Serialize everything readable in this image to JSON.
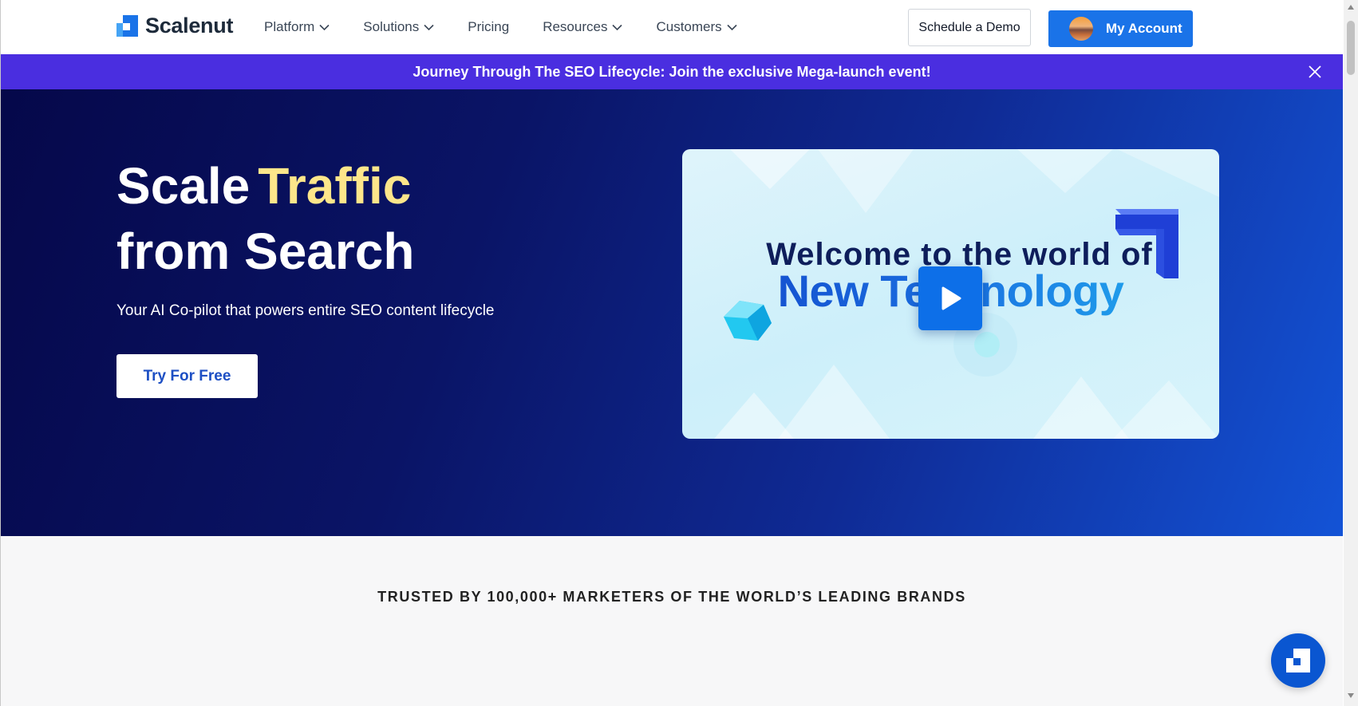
{
  "header": {
    "logo_text": "Scalenut",
    "nav": [
      {
        "label": "Platform",
        "has_dropdown": true
      },
      {
        "label": "Solutions",
        "has_dropdown": true
      },
      {
        "label": "Pricing",
        "has_dropdown": false
      },
      {
        "label": "Resources",
        "has_dropdown": true
      },
      {
        "label": "Customers",
        "has_dropdown": true
      }
    ],
    "schedule_demo": "Schedule a Demo",
    "my_account": "My Account"
  },
  "announcement": {
    "text": "Journey Through The SEO Lifecycle: Join the exclusive Mega-launch event!"
  },
  "hero": {
    "title_part1": "Scale",
    "title_accent": "Traffic",
    "title_line2": "from Search",
    "subtitle": "Your AI Co-pilot that powers entire SEO content lifecycle",
    "cta": "Try For Free",
    "video": {
      "line1": "Welcome to the world of",
      "line2": "New Technology"
    }
  },
  "trusted": {
    "text": "TRUSTED BY 100,000+ MARKETERS OF THE WORLD’S LEADING BRANDS"
  },
  "colors": {
    "brand_blue": "#1a73e8",
    "announcement_bg": "#4a2ee0",
    "hero_accent": "#fde68a",
    "hero_dark": "#05084a"
  },
  "icons": [
    "scalenut-logo-icon",
    "chevron-down-icon",
    "close-icon",
    "play-icon",
    "chat-widget-icon"
  ]
}
